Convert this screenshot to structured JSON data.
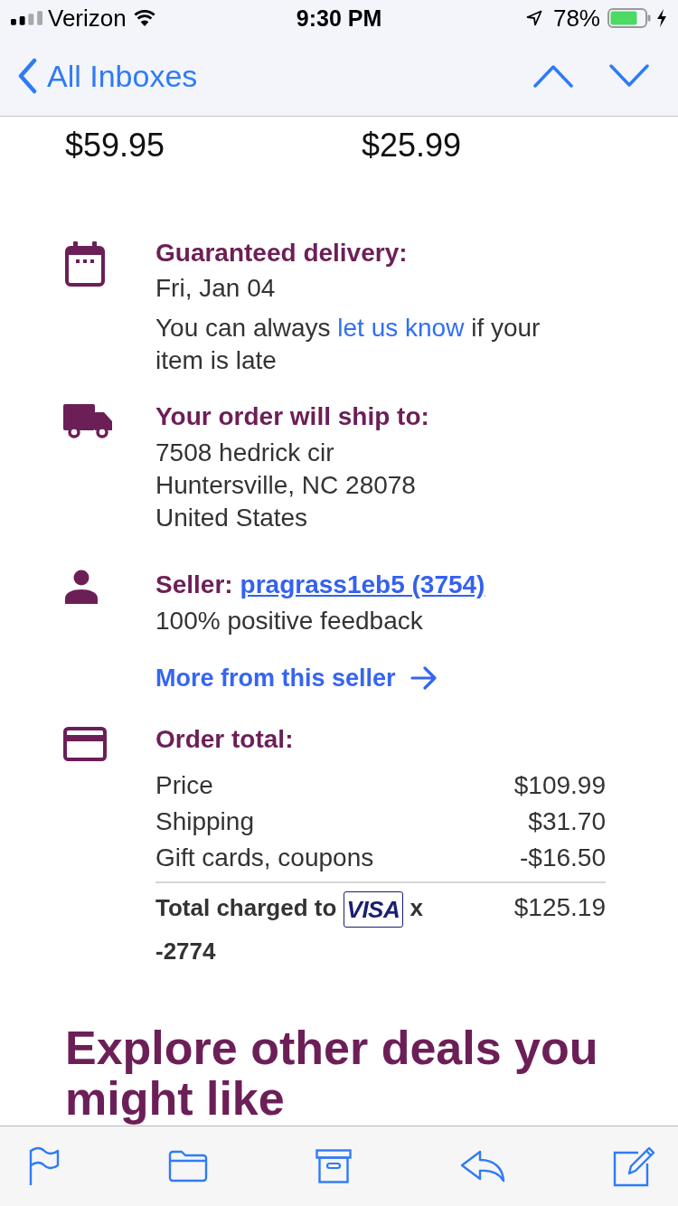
{
  "status_bar": {
    "carrier": "Verizon",
    "time": "9:30 PM",
    "battery": "78%"
  },
  "nav_bar": {
    "back": "All Inboxes"
  },
  "item_prices": [
    "$59.95",
    "$25.99"
  ],
  "delivery": {
    "title": "Guaranteed delivery:",
    "date": "Fri, Jan 04",
    "note_before": "You can always",
    "note_link": "let us know",
    "note_after": "if your item is late"
  },
  "ship_to": {
    "title": "Your order will ship to:",
    "address": [
      "7508 hedrick cir",
      "Huntersville, NC 28078",
      "United States"
    ]
  },
  "seller": {
    "label": "Seller:",
    "name": "pragrass1eb5 (3754)",
    "feedback": "100% positive feedback",
    "more_link": "More from this seller"
  },
  "order_total": {
    "title": "Order total:",
    "lines": [
      {
        "label": "Price",
        "value": "$109.99"
      },
      {
        "label": "Shipping",
        "value": "$31.70"
      },
      {
        "label": "Gift cards, coupons",
        "value": "-$16.50"
      }
    ],
    "total": {
      "label": "Total charged to",
      "card_logo": "VISA",
      "card_mark": "x",
      "card_last4": "-2774",
      "value": "$125.19"
    }
  },
  "promo_heading": "Explore other deals you might like"
}
